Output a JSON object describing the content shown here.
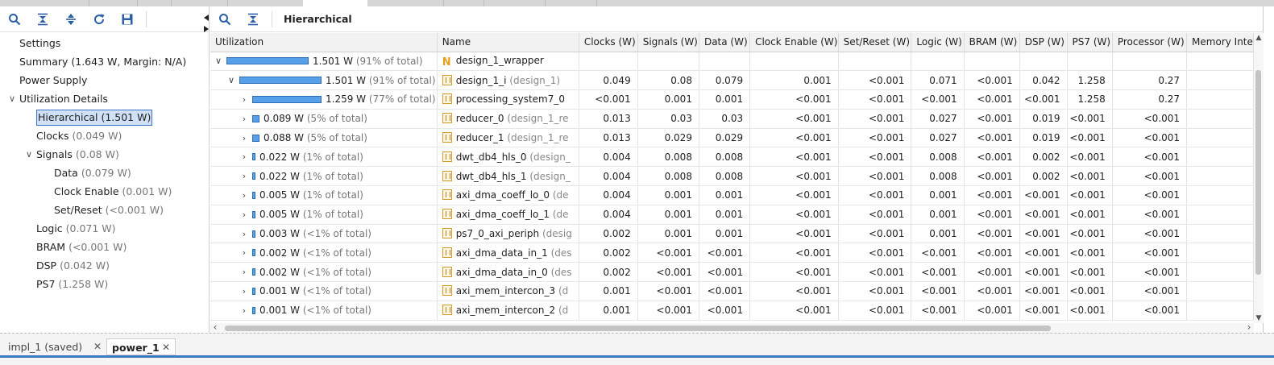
{
  "left_toolbar": {
    "icons": [
      "search-icon",
      "collapse-all-icon",
      "expand-all-icon",
      "refresh-icon",
      "save-icon"
    ]
  },
  "tree": {
    "items": [
      {
        "label": "Settings",
        "suffix": "",
        "level": 0,
        "chevron": ""
      },
      {
        "label": "Summary (1.643 W, Margin: N/A)",
        "suffix": "",
        "level": 0,
        "chevron": ""
      },
      {
        "label": "Power Supply",
        "suffix": "",
        "level": 0,
        "chevron": ""
      },
      {
        "label": "Utilization Details",
        "suffix": "",
        "level": 0,
        "chevron": "down"
      },
      {
        "label": "Hierarchical (1.501 W)",
        "suffix": "",
        "level": 1,
        "chevron": "",
        "selected": true
      },
      {
        "label": "Clocks",
        "suffix": "(0.049 W)",
        "level": 1,
        "chevron": ""
      },
      {
        "label": "Signals",
        "suffix": "(0.08 W)",
        "level": 1,
        "chevron": "down"
      },
      {
        "label": "Data",
        "suffix": "(0.079 W)",
        "level": 2,
        "chevron": ""
      },
      {
        "label": "Clock Enable",
        "suffix": "(0.001 W)",
        "level": 2,
        "chevron": ""
      },
      {
        "label": "Set/Reset",
        "suffix": "(<0.001 W)",
        "level": 2,
        "chevron": ""
      },
      {
        "label": "Logic",
        "suffix": "(0.071 W)",
        "level": 1,
        "chevron": ""
      },
      {
        "label": "BRAM",
        "suffix": "(<0.001 W)",
        "level": 1,
        "chevron": ""
      },
      {
        "label": "DSP",
        "suffix": "(0.042 W)",
        "level": 1,
        "chevron": ""
      },
      {
        "label": "PS7",
        "suffix": "(1.258 W)",
        "level": 1,
        "chevron": ""
      }
    ]
  },
  "right_toolbar": {
    "title": "Hierarchical",
    "icons": [
      "search-icon",
      "collapse-all-icon"
    ]
  },
  "table": {
    "columns": [
      "Utilization",
      "Name",
      "Clocks (W)",
      "Signals (W)",
      "Data (W)",
      "Clock Enable (W)",
      "Set/Reset (W)",
      "Logic (W)",
      "BRAM (W)",
      "DSP (W)",
      "PS7 (W)",
      "Processor (W)",
      "Memory Inte"
    ],
    "rows": [
      {
        "depth": 0,
        "chev": "down",
        "fraction": 0.91,
        "value": "1.501 W",
        "pct": "(91% of total)",
        "icon": "top",
        "name": "design_1_wrapper",
        "name_dim": "",
        "cells": [
          "",
          "",
          "",
          "",
          "",
          "",
          "",
          "",
          "",
          "",
          ""
        ]
      },
      {
        "depth": 1,
        "chev": "down",
        "fraction": 0.91,
        "value": "1.501 W",
        "pct": "(91% of total)",
        "icon": "cell",
        "name": "design_1_i",
        "name_dim": "(design_1)",
        "cells": [
          "0.049",
          "0.08",
          "0.079",
          "0.001",
          "<0.001",
          "0.071",
          "<0.001",
          "0.042",
          "1.258",
          "0.27",
          ""
        ]
      },
      {
        "depth": 2,
        "chev": "right",
        "fraction": 0.77,
        "value": "1.259 W",
        "pct": "(77% of total)",
        "icon": "cell",
        "name": "processing_system7_0",
        "name_dim": "",
        "cells": [
          "<0.001",
          "0.001",
          "0.001",
          "<0.001",
          "<0.001",
          "<0.001",
          "<0.001",
          "<0.001",
          "1.258",
          "0.27",
          ""
        ]
      },
      {
        "depth": 2,
        "chev": "right",
        "fraction": 0.05,
        "value": "0.089 W",
        "pct": "(5% of total)",
        "icon": "cell",
        "name": "reducer_0",
        "name_dim": "(design_1_re",
        "cells": [
          "0.013",
          "0.03",
          "0.03",
          "<0.001",
          "<0.001",
          "0.027",
          "<0.001",
          "0.019",
          "<0.001",
          "<0.001",
          ""
        ]
      },
      {
        "depth": 2,
        "chev": "right",
        "fraction": 0.05,
        "value": "0.088 W",
        "pct": "(5% of total)",
        "icon": "cell",
        "name": "reducer_1",
        "name_dim": "(design_1_re",
        "cells": [
          "0.013",
          "0.029",
          "0.029",
          "<0.001",
          "<0.001",
          "0.027",
          "<0.001",
          "0.019",
          "<0.001",
          "<0.001",
          ""
        ]
      },
      {
        "depth": 2,
        "chev": "right",
        "fraction": 0.01,
        "value": "0.022 W",
        "pct": "(1% of total)",
        "icon": "cell",
        "name": "dwt_db4_hls_0",
        "name_dim": "(design_",
        "cells": [
          "0.004",
          "0.008",
          "0.008",
          "<0.001",
          "<0.001",
          "0.008",
          "<0.001",
          "0.002",
          "<0.001",
          "<0.001",
          ""
        ]
      },
      {
        "depth": 2,
        "chev": "right",
        "fraction": 0.01,
        "value": "0.022 W",
        "pct": "(1% of total)",
        "icon": "cell",
        "name": "dwt_db4_hls_1",
        "name_dim": "(design_",
        "cells": [
          "0.004",
          "0.008",
          "0.008",
          "<0.001",
          "<0.001",
          "0.008",
          "<0.001",
          "0.002",
          "<0.001",
          "<0.001",
          ""
        ]
      },
      {
        "depth": 2,
        "chev": "right",
        "fraction": 0.01,
        "value": "0.005 W",
        "pct": "(1% of total)",
        "icon": "cell",
        "name": "axi_dma_coeff_lo_0",
        "name_dim": "(de",
        "cells": [
          "0.004",
          "0.001",
          "0.001",
          "<0.001",
          "<0.001",
          "0.001",
          "<0.001",
          "<0.001",
          "<0.001",
          "<0.001",
          ""
        ]
      },
      {
        "depth": 2,
        "chev": "right",
        "fraction": 0.01,
        "value": "0.005 W",
        "pct": "(1% of total)",
        "icon": "cell",
        "name": "axi_dma_coeff_lo_1",
        "name_dim": "(de",
        "cells": [
          "0.004",
          "0.001",
          "0.001",
          "<0.001",
          "<0.001",
          "0.001",
          "<0.001",
          "<0.001",
          "<0.001",
          "<0.001",
          ""
        ]
      },
      {
        "depth": 2,
        "chev": "right",
        "fraction": 0.01,
        "value": "0.003 W",
        "pct": "(<1% of total)",
        "icon": "cell",
        "name": "ps7_0_axi_periph",
        "name_dim": "(desig",
        "cells": [
          "0.002",
          "0.001",
          "0.001",
          "<0.001",
          "<0.001",
          "0.001",
          "<0.001",
          "<0.001",
          "<0.001",
          "<0.001",
          ""
        ]
      },
      {
        "depth": 2,
        "chev": "right",
        "fraction": 0.01,
        "value": "0.002 W",
        "pct": "(<1% of total)",
        "icon": "cell",
        "name": "axi_dma_data_in_1",
        "name_dim": "(des",
        "cells": [
          "0.002",
          "<0.001",
          "<0.001",
          "<0.001",
          "<0.001",
          "<0.001",
          "<0.001",
          "<0.001",
          "<0.001",
          "<0.001",
          ""
        ]
      },
      {
        "depth": 2,
        "chev": "right",
        "fraction": 0.01,
        "value": "0.002 W",
        "pct": "(<1% of total)",
        "icon": "cell",
        "name": "axi_dma_data_in_0",
        "name_dim": "(des",
        "cells": [
          "0.002",
          "<0.001",
          "<0.001",
          "<0.001",
          "<0.001",
          "<0.001",
          "<0.001",
          "<0.001",
          "<0.001",
          "<0.001",
          ""
        ]
      },
      {
        "depth": 2,
        "chev": "right",
        "fraction": 0.01,
        "value": "0.001 W",
        "pct": "(<1% of total)",
        "icon": "cell",
        "name": "axi_mem_intercon_3",
        "name_dim": "(d",
        "cells": [
          "0.001",
          "<0.001",
          "<0.001",
          "<0.001",
          "<0.001",
          "<0.001",
          "<0.001",
          "<0.001",
          "<0.001",
          "<0.001",
          ""
        ]
      },
      {
        "depth": 2,
        "chev": "right",
        "fraction": 0.01,
        "value": "0.001 W",
        "pct": "(<1% of total)",
        "icon": "cell",
        "name": "axi_mem_intercon_2",
        "name_dim": "(d",
        "cells": [
          "0.001",
          "<0.001",
          "<0.001",
          "<0.001",
          "<0.001",
          "<0.001",
          "<0.001",
          "<0.001",
          "<0.001",
          "<0.001",
          ""
        ]
      }
    ]
  },
  "bottom_tabs": [
    {
      "label": "impl_1 (saved)",
      "active": false
    },
    {
      "label": "power_1",
      "active": true
    }
  ],
  "colors": {
    "accent": "#3d78c4",
    "bar_fill": "#55a0e6",
    "bar_border": "#2d6db8",
    "cell_icon": "#d49a2a"
  }
}
